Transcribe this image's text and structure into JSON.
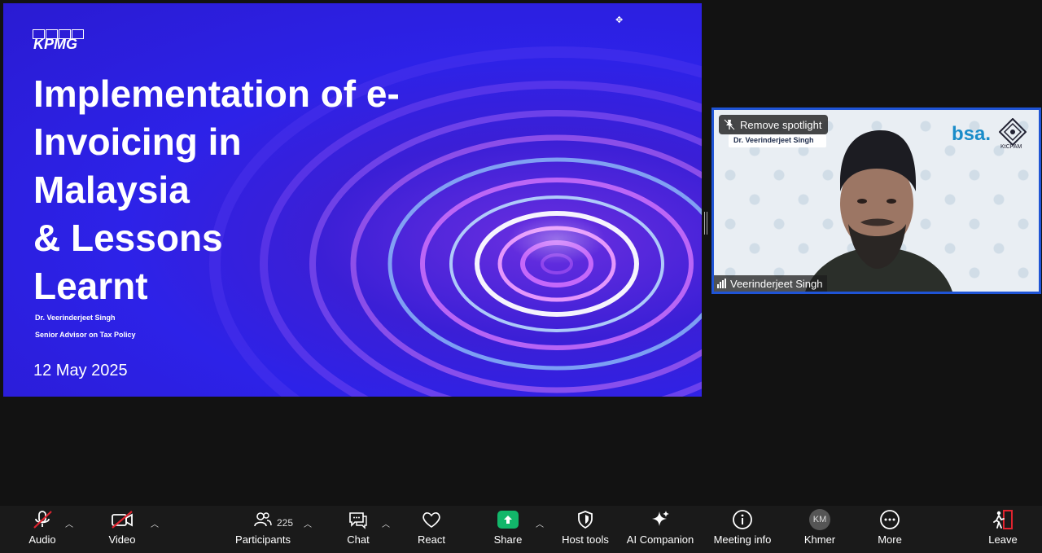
{
  "slide": {
    "logo": "KPMG",
    "title": "Implementation of e-\nInvoicing in\nMalaysia\n& Lessons\nLearnt",
    "presenter_name": "Dr. Veerinderjeet Singh",
    "presenter_role": "Senior Advisor on Tax Policy",
    "date": "12 May 2025"
  },
  "video_tile": {
    "remove_spotlight_label": "Remove spotlight",
    "participant_name": "Veerinderjeet Singh",
    "background_name_card": "Dr. Veerinderjeet Singh",
    "background_logo": "bsa.",
    "background_emblem_text": "KtCPAM"
  },
  "toolbar": {
    "audio": "Audio",
    "video": "Video",
    "participants": "Participants",
    "participants_count": "225",
    "chat": "Chat",
    "react": "React",
    "share": "Share",
    "host_tools": "Host tools",
    "ai_companion": "AI Companion",
    "meeting_info": "Meeting info",
    "language": "Khmer",
    "language_avatar": "KM",
    "more": "More",
    "leave": "Leave"
  },
  "colors": {
    "share_green": "#12b76a",
    "muted_red": "#e0242f",
    "leave_red": "#e0242f",
    "spotlight_border": "#1f54d6"
  }
}
